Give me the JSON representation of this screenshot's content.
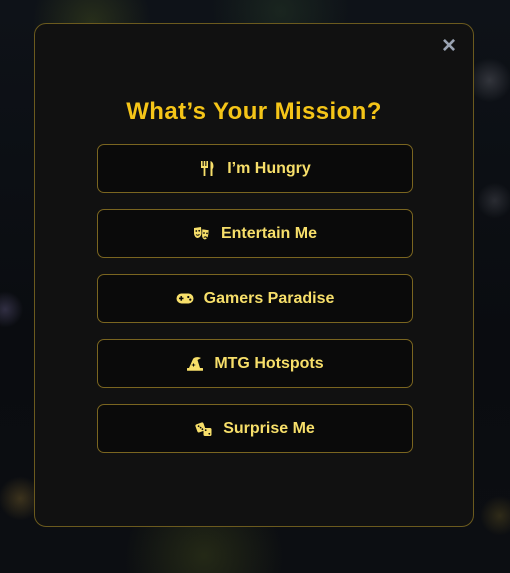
{
  "modal": {
    "close_label": "×",
    "title": "What’s Your Mission?",
    "options": [
      {
        "label": "I’m Hungry",
        "icon": "utensils-icon"
      },
      {
        "label": "Entertain Me",
        "icon": "theater-masks-icon"
      },
      {
        "label": "Gamers Paradise",
        "icon": "gamepad-icon"
      },
      {
        "label": "MTG Hotspots",
        "icon": "hat-wizard-icon"
      },
      {
        "label": "Surprise Me",
        "icon": "dice-icon"
      }
    ]
  },
  "colors": {
    "accent": "#f5c518",
    "button_text": "#f7df6a",
    "border": "#7a6520",
    "modal_bg": "#111111"
  }
}
